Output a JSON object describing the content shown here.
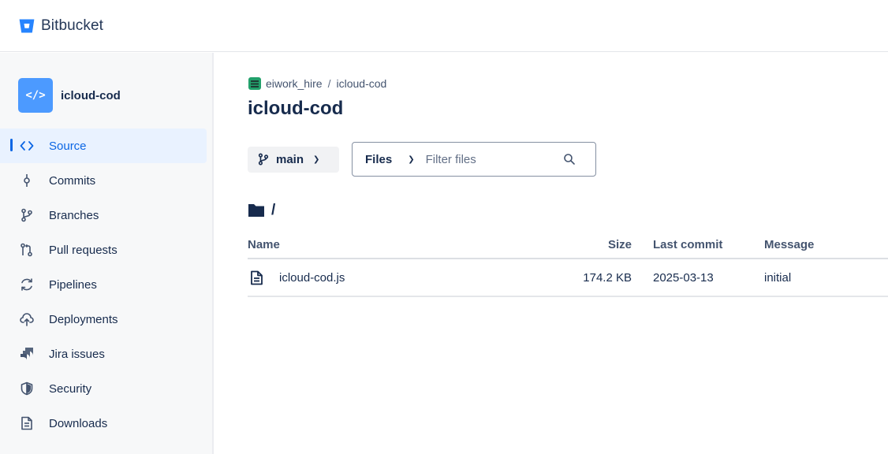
{
  "app": {
    "name": "Bitbucket"
  },
  "sidebar": {
    "repo_name": "icloud-cod",
    "repo_avatar_glyph": "</>",
    "items": [
      {
        "label": "Source",
        "icon": "code-icon",
        "active": true
      },
      {
        "label": "Commits",
        "icon": "commit-icon",
        "active": false
      },
      {
        "label": "Branches",
        "icon": "branch-icon",
        "active": false
      },
      {
        "label": "Pull requests",
        "icon": "pull-request-icon",
        "active": false
      },
      {
        "label": "Pipelines",
        "icon": "pipelines-icon",
        "active": false
      },
      {
        "label": "Deployments",
        "icon": "cloud-upload-icon",
        "active": false
      },
      {
        "label": "Jira issues",
        "icon": "jira-icon",
        "active": false
      },
      {
        "label": "Security",
        "icon": "shield-icon",
        "active": false
      },
      {
        "label": "Downloads",
        "icon": "document-icon",
        "active": false
      }
    ]
  },
  "breadcrumb": {
    "workspace": "eiwork_hire",
    "separator": "/",
    "repo": "icloud-cod"
  },
  "page_title": "icloud-cod",
  "toolbar": {
    "branch": "main",
    "filter_type": "Files",
    "filter_placeholder": "Filter files"
  },
  "path": "/",
  "table": {
    "headers": {
      "name": "Name",
      "size": "Size",
      "last_commit": "Last commit",
      "message": "Message"
    },
    "rows": [
      {
        "name": "icloud-cod.js",
        "size": "174.2 KB",
        "last_commit": "2025-03-13",
        "message": "initial"
      }
    ]
  },
  "colors": {
    "accent": "#0c66e4",
    "active_bg": "#e9f2ff",
    "sidebar_bg": "#f7f8f9",
    "avatar": "#4c9aff",
    "text": "#172b4d"
  }
}
